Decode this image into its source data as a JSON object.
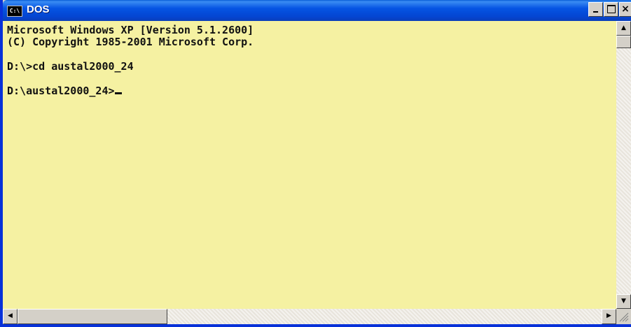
{
  "window": {
    "title": "DOS",
    "icon": "console-icon",
    "icon_text": "C:\\",
    "buttons": {
      "minimize": "minimize",
      "maximize": "maximize",
      "close": "×"
    }
  },
  "console": {
    "lines": [
      "Microsoft Windows XP [Version 5.1.2600]",
      "(C) Copyright 1985-2001 Microsoft Corp.",
      "",
      "D:\\>cd austal2000_24",
      "",
      "D:\\austal2000_24>"
    ],
    "background_color": "#f5f1a2",
    "text_color": "#111111"
  },
  "scrollbars": {
    "up_arrow": "▲",
    "down_arrow": "▼",
    "left_arrow": "◀",
    "right_arrow": "▶"
  },
  "colors": {
    "title_bar": "#0554e3",
    "frame": "#0831d9"
  }
}
